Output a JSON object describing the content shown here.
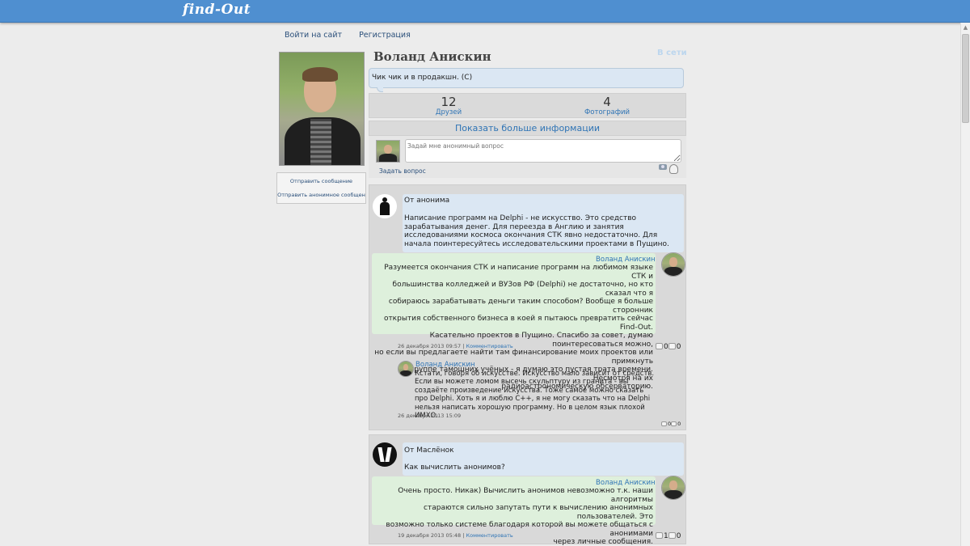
{
  "header": {
    "logo": "find-Out"
  },
  "nav": {
    "login": "Войти на сайт",
    "register": "Регистрация"
  },
  "profile": {
    "name": "Воланд Анискин",
    "online": "В сети",
    "status": "Чик чик и в продакшн. (С)",
    "side_links": [
      "Отправить сообщение",
      "Отправить анонимное сообщен"
    ],
    "stats": [
      {
        "count": "12",
        "label": "Друзей"
      },
      {
        "count": "4",
        "label": "Фотографий"
      }
    ],
    "more_info": "Показать больше информации"
  },
  "ask": {
    "placeholder": "Задай мне анонимный вопрос",
    "button": "Задать вопрос",
    "icons": [
      "camera-icon",
      "anonymous-toggle-icon"
    ]
  },
  "questions": [
    {
      "from": "От анонима",
      "question": "Написание программ на Delphi - не искусство. Это средство зарабатывания денег. Для переезда в Англию и занятия исследованиями космоса окончания СТК явно недостаточно. Для начала поинтересуйтесь исследовательскими проектами в Пущино.",
      "answer_author": "Воланд Анискин",
      "answer": "Разумеется окончания СТК и написание программ на любимом языке СТК и\nбольшинства колледжей и ВУЗов РФ (Delphi) не достаточно, но кто сказал что я\nсобираюсь зарабатывать деньги таким способом? Вообще я больше сторонник\nоткрытия собственного бизнеса в коей я пытаюсь превратить сейчас Find-Out.\nКасательно проектов в Пущино. Спасибо за совет, думаю поинтересоваться можно,\nно если вы предлагаете найти там финансирование моих проектов или примкнуть\nк группе тамошних учёных - я думаю это пустая трата времени. Несмотря на их\nрадиоастрономическую обсерваторию.",
      "date": "26 декабря 2013 09:57",
      "comment_link": "Комментировать",
      "likes": "0",
      "dislikes": "0",
      "comment": {
        "author": "Воланд Анискин",
        "text": "Кстати, говоря об искусстве. Искусство мало зависит от средств. Если вы можете ломом высечь скульптуру из гранита - вы создаёте произведение искусства. Тоже самое можно сказать про Delphi. Хоть я и люблю С++, я не могу сказать что на Delphi нельзя написать хорошую программу. Но в целом язык плохой ИМХО.",
        "date": "26 декабря 2013 15:09",
        "likes": "0",
        "dislikes": "0"
      }
    },
    {
      "from": "От Маслёнок",
      "question": "Как вычислить анонимов?",
      "answer_author": "Воланд Анискин",
      "answer": "Очень просто. Никак) Вычислить анонимов невозможно т.к. наши алгоритмы\nстараются сильно запутать пути к вычислению анонимных пользователей. Это\nвозможно только системе благодаря которой вы можете общаться с анонимами\nчерез личные сообщения.",
      "date": "19 декабря 2013 05:48",
      "comment_link": "Комментировать",
      "likes": "1",
      "dislikes": "0"
    }
  ]
}
